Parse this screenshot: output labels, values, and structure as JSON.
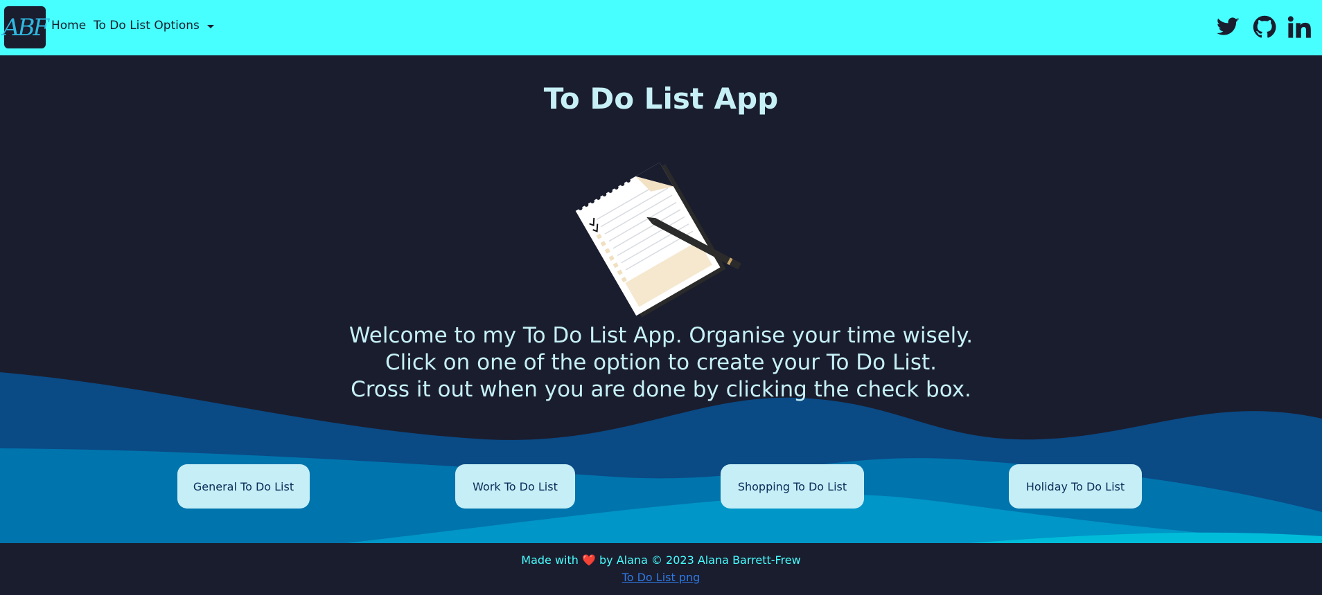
{
  "nav": {
    "logo_text": "ABF",
    "home_label": "Home",
    "options_label": "To Do List Options",
    "social": [
      "twitter-icon",
      "github-icon",
      "linkedin-icon"
    ]
  },
  "hero": {
    "title": "To Do List App",
    "welcome_lines": [
      "Welcome to my To Do List App. Organise your time wisely.",
      "Click on one of the option to create your To Do List.",
      "Cross it out when you are done by clicking the check box."
    ]
  },
  "buttons": {
    "general": "General To Do List",
    "work": "Work To Do List",
    "shopping": "Shopping To Do List",
    "holiday": "Holiday To Do List"
  },
  "footer": {
    "made_prefix": "Made with",
    "heart": "❤️",
    "made_suffix": "by Alana © 2023 Alana Barrett-Frew",
    "credit_link": "To Do List png"
  },
  "colors": {
    "navbar": "#48ffff",
    "background": "#1a1d2e",
    "text_light": "#c6f0f6",
    "button_bg": "#c6eef6",
    "button_text": "#0a2c5a"
  }
}
